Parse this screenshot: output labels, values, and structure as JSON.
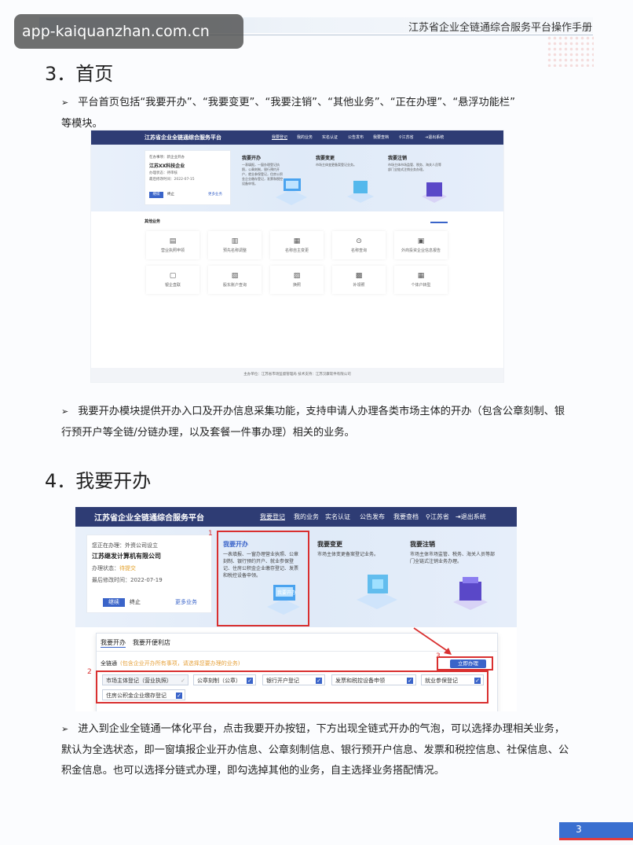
{
  "header": {
    "manual_title": "江苏省企业全链通综合服务平台操作手册"
  },
  "watermark": "app-kaiquanzhan.com.cn",
  "section3": {
    "heading": "3．首页",
    "intro_line1": "平台首页包括“我要开办”、“我要变更”、“我要注销”、“其他业务”、“正在办理”、“悬浮功能栏”",
    "intro_line2": "等模块。",
    "after_line1": "我要开办模块提供开办入口及开办信息采集功能，支持申请人办理各类市场主体的开办（包含公章刻制、银",
    "after_line2": "行预开户等全链/分链办理，以及套餐一件事办理）相关的业务。"
  },
  "screenshot1": {
    "app_title": "江苏省企业全链通综合服务平台",
    "nav": [
      "我要登记",
      "我的业务",
      "实名认证",
      "公告发布",
      "我要查档",
      "江苏省",
      "退出系统"
    ],
    "doing_label": "在办事项：新企业开办",
    "company": "江苏XX科技企业",
    "status": "办理状态：待审核",
    "modified": "最后修改时间：2022-07-15",
    "continue_btn": "继续",
    "stop_btn": "终止",
    "more": "更多业务",
    "open_title": "我要开办",
    "open_desc": "一表填报，一窗办理登记执照，公章刻制，银行预约开户，就业参保登记，住房公积金企业缴存登记，发票和税控设备申领。",
    "change_title": "我要变更",
    "change_desc": "市场主体变更备案登记业务。",
    "cancel_title": "我要注销",
    "cancel_desc": "市场主体市场监管、税务、海关人员等部门全链式注销业务办理。",
    "other_title": "其他业务",
    "grid": [
      "营业执照申领",
      "预先名称调整",
      "名称自主变更",
      "名称查询",
      "外商投资企业信息报告",
      "银企直联",
      "股东账户查询",
      "换照",
      "补领照",
      "个体户转型"
    ],
    "footer": "主办单位：江苏省市场监督管理局   技术支持：江苏汉康软件有限公司"
  },
  "section4": {
    "heading": "4．我要开办",
    "desc_line1": "进入到企业全链通一体化平台，点击我要开办按钮，下方出现全链式开办的气泡，可以选择办理相关业务，",
    "desc_line2": "默认为全选状态，即一窗填报企业开办信息、公章刻制信息、银行预开户信息、发票和税控信息、社保信息、公",
    "desc_line3": "积金信息。也可以选择分链式办理，即勾选掉其他的业务，自主选择业务搭配情况。"
  },
  "screenshot2": {
    "app_title": "江苏省企业全链通综合服务平台",
    "nav": [
      "我要登记",
      "我的业务",
      "实名认证",
      "公告发布",
      "我要查档",
      "江苏省",
      "退出系统"
    ],
    "doing_label": "您正在办理：外资公司设立",
    "company": "江苏继发计算机有限公司",
    "status_label": "办理状态：",
    "status_value": "待提交",
    "modified": "最后修改时间：2022-07-19",
    "continue_btn": "继续",
    "stop_btn": "终止",
    "more": "更多业务",
    "open_title": "我要开办",
    "open_desc": "一表填报、一窗办理营业执照、公章刻制、银行预约开户、就业参保登记、住房公积金企业缴存登记、发票和税控设备申领。",
    "change_title": "我要变更",
    "change_desc": "市场主体变更备案登记业务。",
    "cancel_title": "我要注销",
    "cancel_desc": "市场主体市场监管、税务、海关人员等部门全链式注销业务办理。",
    "tabs": [
      "我要开办",
      "我要开便利店"
    ],
    "chain_label": "全链通",
    "chain_hint": "(包含企业开办所有事项，请选择您要办理的业务)",
    "apply_btn": "立即办理",
    "options": [
      "市场主体登记（营业执照）",
      "公章刻制（公章）",
      "银行开户登记",
      "发票和税控设备申领",
      "就业参保登记",
      "住房公积金企业缴存登记"
    ],
    "markers": [
      "1",
      "2",
      "3"
    ]
  },
  "page_number": "3"
}
